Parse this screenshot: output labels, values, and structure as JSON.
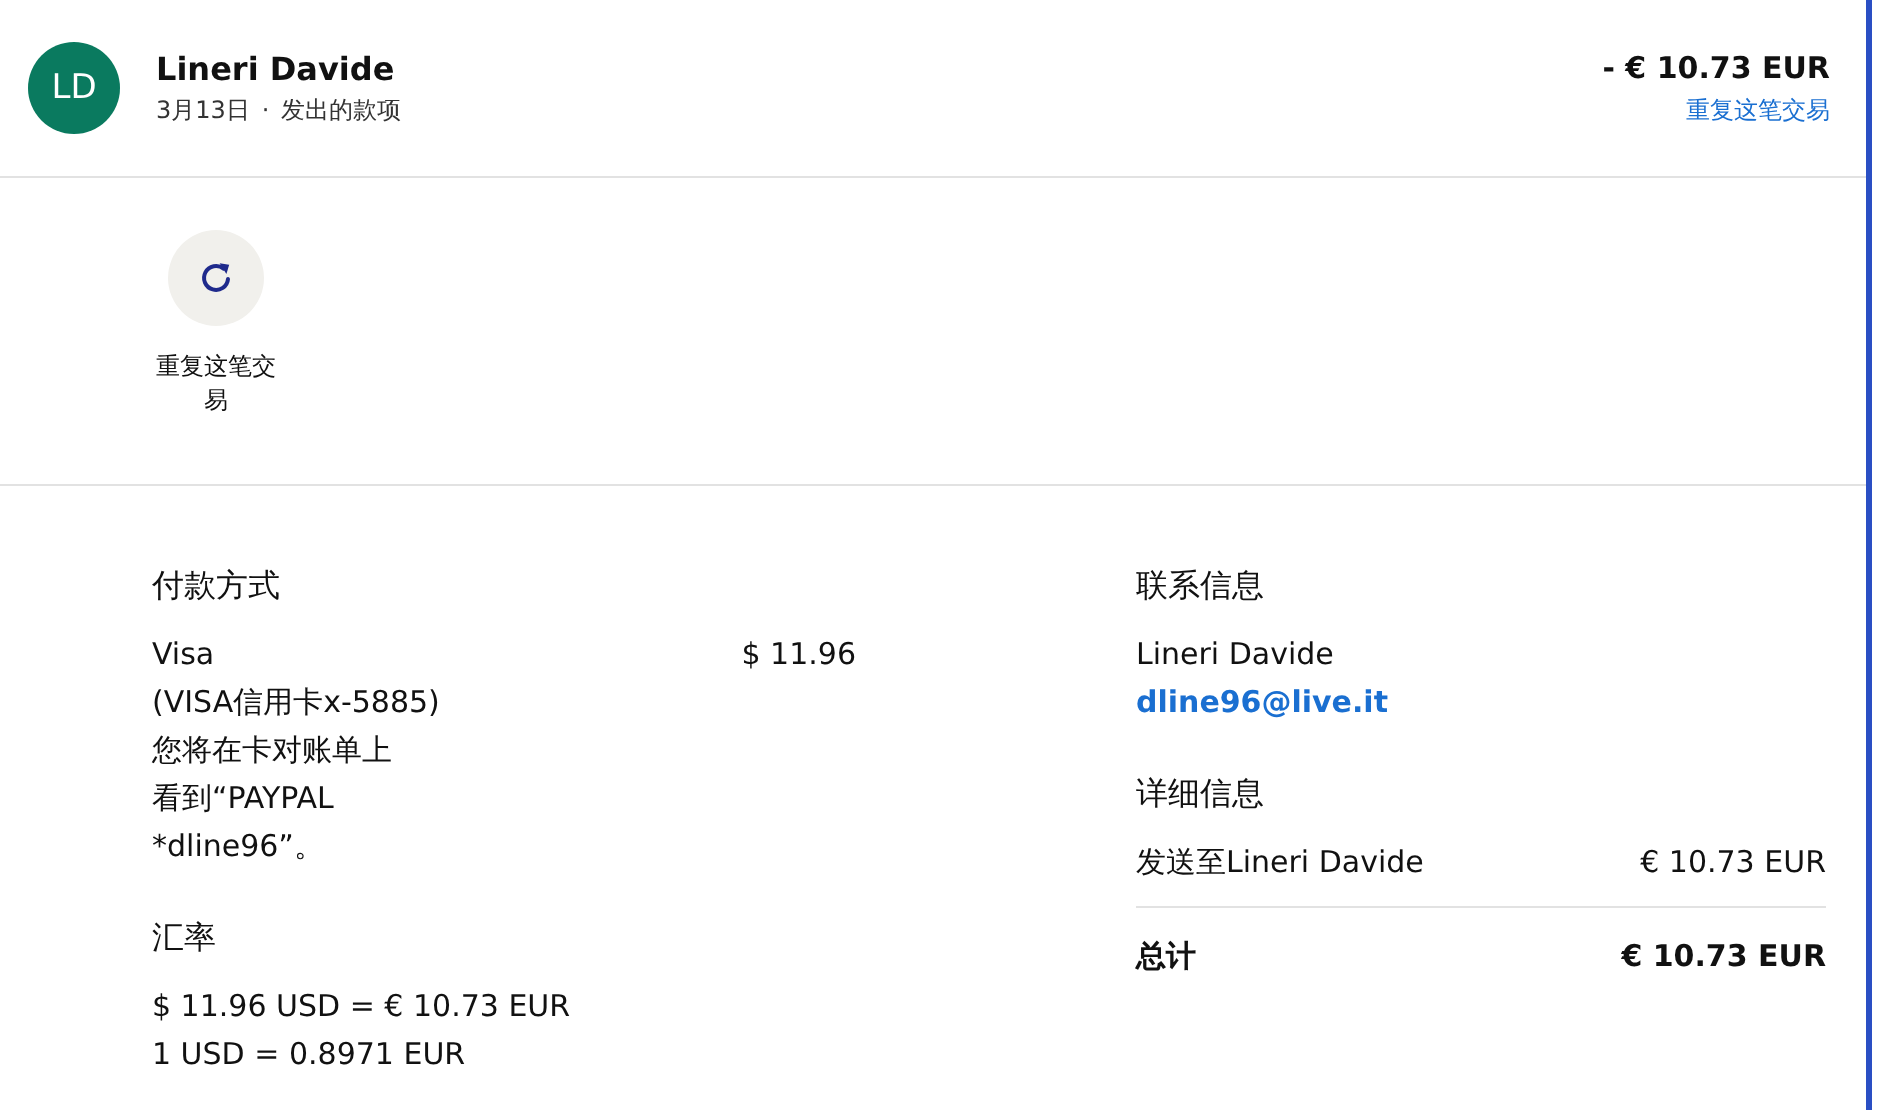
{
  "header": {
    "avatar": "LD",
    "name": "Lineri Davide",
    "date": "3月13日",
    "separator": "·",
    "type": "发出的款项",
    "amount": "- € 10.73 EUR",
    "repeat_link": "重复这笔交易"
  },
  "actions": [
    {
      "label": "重复这笔交易"
    }
  ],
  "payment": {
    "heading": "付款方式",
    "method": "Visa",
    "card": "(VISA信用卡x-5885)",
    "note": "您将在卡对账单上看到“PAYPAL *dline96”。",
    "amount": "$ 11.96"
  },
  "exchange": {
    "heading": "汇率",
    "lines": [
      "$ 11.96 USD = € 10.73 EUR",
      "1 USD = 0.8971 EUR"
    ]
  },
  "contact": {
    "heading": "联系信息",
    "name": "Lineri Davide",
    "email": "dline96@live.it"
  },
  "details": {
    "heading": "详细信息",
    "rows": [
      {
        "label": "发送至Lineri Davide",
        "value": "€ 10.73 EUR"
      }
    ],
    "total": {
      "label": "总计",
      "value": "€ 10.73 EUR"
    }
  }
}
